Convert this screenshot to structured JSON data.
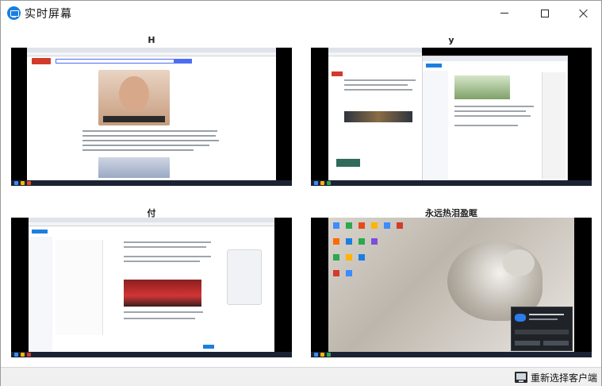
{
  "window": {
    "title": "实时屏幕"
  },
  "clients": [
    {
      "name": "H"
    },
    {
      "name": "y"
    },
    {
      "name": "付"
    },
    {
      "name": "永远热泪盈眶"
    }
  ],
  "statusbar": {
    "reselect_label": "重新选择客户端"
  },
  "icons": {
    "app": "monitor-app-icon",
    "reselect": "monitor-icon",
    "minimize": "minimize-icon",
    "maximize": "maximize-icon",
    "close": "close-icon"
  },
  "colors": {
    "screen_bg": "#000000",
    "titlebar_bg": "#ffffff",
    "status_bg": "#f0f0f0",
    "accent": "#1a7fe0"
  }
}
